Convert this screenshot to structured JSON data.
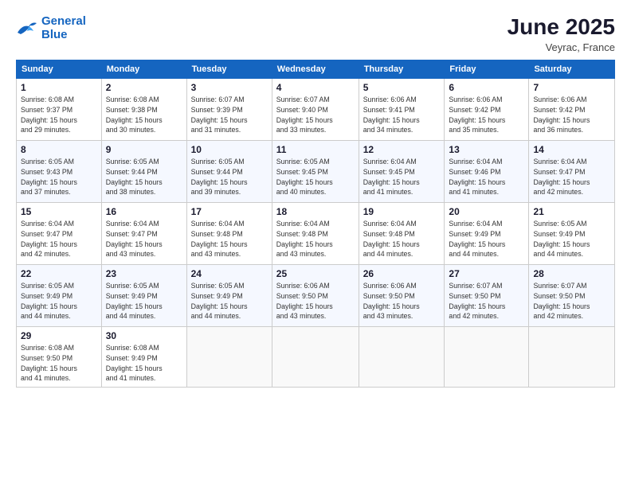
{
  "logo": {
    "line1": "General",
    "line2": "Blue"
  },
  "title": "June 2025",
  "location": "Veyrac, France",
  "headers": [
    "Sunday",
    "Monday",
    "Tuesday",
    "Wednesday",
    "Thursday",
    "Friday",
    "Saturday"
  ],
  "weeks": [
    [
      {
        "day": "1",
        "sunrise": "6:08 AM",
        "sunset": "9:37 PM",
        "daylight": "15 hours and 29 minutes."
      },
      {
        "day": "2",
        "sunrise": "6:08 AM",
        "sunset": "9:38 PM",
        "daylight": "15 hours and 30 minutes."
      },
      {
        "day": "3",
        "sunrise": "6:07 AM",
        "sunset": "9:39 PM",
        "daylight": "15 hours and 31 minutes."
      },
      {
        "day": "4",
        "sunrise": "6:07 AM",
        "sunset": "9:40 PM",
        "daylight": "15 hours and 33 minutes."
      },
      {
        "day": "5",
        "sunrise": "6:06 AM",
        "sunset": "9:41 PM",
        "daylight": "15 hours and 34 minutes."
      },
      {
        "day": "6",
        "sunrise": "6:06 AM",
        "sunset": "9:42 PM",
        "daylight": "15 hours and 35 minutes."
      },
      {
        "day": "7",
        "sunrise": "6:06 AM",
        "sunset": "9:42 PM",
        "daylight": "15 hours and 36 minutes."
      }
    ],
    [
      {
        "day": "8",
        "sunrise": "6:05 AM",
        "sunset": "9:43 PM",
        "daylight": "15 hours and 37 minutes."
      },
      {
        "day": "9",
        "sunrise": "6:05 AM",
        "sunset": "9:44 PM",
        "daylight": "15 hours and 38 minutes."
      },
      {
        "day": "10",
        "sunrise": "6:05 AM",
        "sunset": "9:44 PM",
        "daylight": "15 hours and 39 minutes."
      },
      {
        "day": "11",
        "sunrise": "6:05 AM",
        "sunset": "9:45 PM",
        "daylight": "15 hours and 40 minutes."
      },
      {
        "day": "12",
        "sunrise": "6:04 AM",
        "sunset": "9:45 PM",
        "daylight": "15 hours and 41 minutes."
      },
      {
        "day": "13",
        "sunrise": "6:04 AM",
        "sunset": "9:46 PM",
        "daylight": "15 hours and 41 minutes."
      },
      {
        "day": "14",
        "sunrise": "6:04 AM",
        "sunset": "9:47 PM",
        "daylight": "15 hours and 42 minutes."
      }
    ],
    [
      {
        "day": "15",
        "sunrise": "6:04 AM",
        "sunset": "9:47 PM",
        "daylight": "15 hours and 42 minutes."
      },
      {
        "day": "16",
        "sunrise": "6:04 AM",
        "sunset": "9:47 PM",
        "daylight": "15 hours and 43 minutes."
      },
      {
        "day": "17",
        "sunrise": "6:04 AM",
        "sunset": "9:48 PM",
        "daylight": "15 hours and 43 minutes."
      },
      {
        "day": "18",
        "sunrise": "6:04 AM",
        "sunset": "9:48 PM",
        "daylight": "15 hours and 43 minutes."
      },
      {
        "day": "19",
        "sunrise": "6:04 AM",
        "sunset": "9:48 PM",
        "daylight": "15 hours and 44 minutes."
      },
      {
        "day": "20",
        "sunrise": "6:04 AM",
        "sunset": "9:49 PM",
        "daylight": "15 hours and 44 minutes."
      },
      {
        "day": "21",
        "sunrise": "6:05 AM",
        "sunset": "9:49 PM",
        "daylight": "15 hours and 44 minutes."
      }
    ],
    [
      {
        "day": "22",
        "sunrise": "6:05 AM",
        "sunset": "9:49 PM",
        "daylight": "15 hours and 44 minutes."
      },
      {
        "day": "23",
        "sunrise": "6:05 AM",
        "sunset": "9:49 PM",
        "daylight": "15 hours and 44 minutes."
      },
      {
        "day": "24",
        "sunrise": "6:05 AM",
        "sunset": "9:49 PM",
        "daylight": "15 hours and 44 minutes."
      },
      {
        "day": "25",
        "sunrise": "6:06 AM",
        "sunset": "9:50 PM",
        "daylight": "15 hours and 43 minutes."
      },
      {
        "day": "26",
        "sunrise": "6:06 AM",
        "sunset": "9:50 PM",
        "daylight": "15 hours and 43 minutes."
      },
      {
        "day": "27",
        "sunrise": "6:07 AM",
        "sunset": "9:50 PM",
        "daylight": "15 hours and 42 minutes."
      },
      {
        "day": "28",
        "sunrise": "6:07 AM",
        "sunset": "9:50 PM",
        "daylight": "15 hours and 42 minutes."
      }
    ],
    [
      {
        "day": "29",
        "sunrise": "6:08 AM",
        "sunset": "9:50 PM",
        "daylight": "15 hours and 41 minutes."
      },
      {
        "day": "30",
        "sunrise": "6:08 AM",
        "sunset": "9:49 PM",
        "daylight": "15 hours and 41 minutes."
      },
      null,
      null,
      null,
      null,
      null
    ]
  ],
  "labels": {
    "sunrise": "Sunrise:",
    "sunset": "Sunset:",
    "daylight": "Daylight:"
  }
}
